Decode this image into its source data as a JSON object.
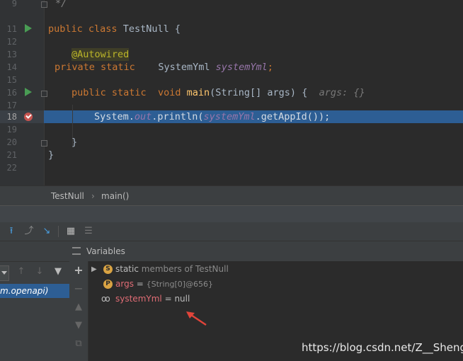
{
  "editor": {
    "lines": [
      {
        "num": "9",
        "text": "*/"
      },
      {
        "num": "11"
      },
      {
        "num": "12"
      },
      {
        "num": "13"
      },
      {
        "num": "14"
      },
      {
        "num": "15"
      },
      {
        "num": "16"
      },
      {
        "num": "17"
      },
      {
        "num": "18"
      },
      {
        "num": "19"
      },
      {
        "num": "20"
      },
      {
        "num": "21"
      },
      {
        "num": "22"
      }
    ],
    "line11": {
      "kw1": "public",
      "kw2": "class",
      "name": "TestNull",
      "brace": "{"
    },
    "line13": {
      "annotation": "@Autowired"
    },
    "line14": {
      "kw1": "private",
      "kw2": "static",
      "type": "SystemYml",
      "field": "systemYml",
      "semi": ";"
    },
    "line16": {
      "kw1": "public",
      "kw2": "static",
      "kw3": "void",
      "method": "main",
      "params": "(String[] args)",
      "brace": "{",
      "hint": "args: {}"
    },
    "line18": {
      "prefix": "System.",
      "out": "out",
      "println": ".println(",
      "field": "systemYml",
      "suffix": ".getAppId());"
    },
    "line20": {
      "brace": "}"
    },
    "line21": {
      "brace": "}"
    }
  },
  "breadcrumb": {
    "class_name": "TestNull",
    "separator": "›",
    "method_name": "main()"
  },
  "frames": {
    "selected_frame": "m.openapi)"
  },
  "variables": {
    "title": "Variables",
    "rows": [
      {
        "badge": "S",
        "badge_color": "#d9a343",
        "name": "static",
        "detail": "members of TestNull"
      },
      {
        "badge": "P",
        "badge_color": "#d9a343",
        "name": "args",
        "eq": " = ",
        "detail": "{String[0]@656}"
      },
      {
        "badge": "oo",
        "name": "systemYml",
        "eq": " = ",
        "value": "null"
      }
    ]
  },
  "watermark": "https://blog.csdn.net/Z__Sheng",
  "colors": {
    "accent": "#2d5e94",
    "arrow": "#e0443a"
  }
}
